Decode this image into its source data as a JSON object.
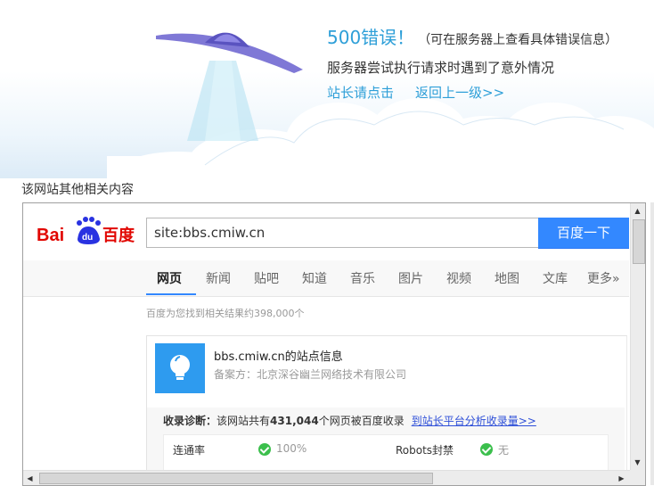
{
  "error": {
    "title": "500错误！",
    "note": "（可在服务器上查看具体错误信息）",
    "description": "服务器尝试执行请求时遇到了意外情况",
    "link_webmaster": "站长请点击",
    "link_back": "返回上一级>>"
  },
  "related_title": "该网站其他相关内容",
  "baidu": {
    "logo_text": "Baidu百度",
    "search_value": "site:bbs.cmiw.cn",
    "search_button": "百度一下",
    "tabs": [
      "网页",
      "新闻",
      "贴吧",
      "知道",
      "音乐",
      "图片",
      "视频",
      "地图",
      "文库",
      "更多»"
    ],
    "result_count": "百度为您找到相关结果约398,000个",
    "site_card": {
      "site_title": "bbs.cmiw.cn的站点信息",
      "beian": "备案方：北京深谷幽兰网络技术有限公司",
      "diag_label": "收录诊断：",
      "diag_text_pre": "该网站共有",
      "diag_count": "431,044",
      "diag_text_post": "个网页被百度收录",
      "diag_link": "到站长平台分析收录量>>",
      "rows": [
        {
          "label": "连通率",
          "value": "100%"
        },
        {
          "label": "Robots封禁",
          "value": "无"
        }
      ]
    }
  },
  "colors": {
    "accent": "#2e9fd8",
    "baidu_blue": "#3388ff",
    "ok_green": "#3bbf4c"
  }
}
